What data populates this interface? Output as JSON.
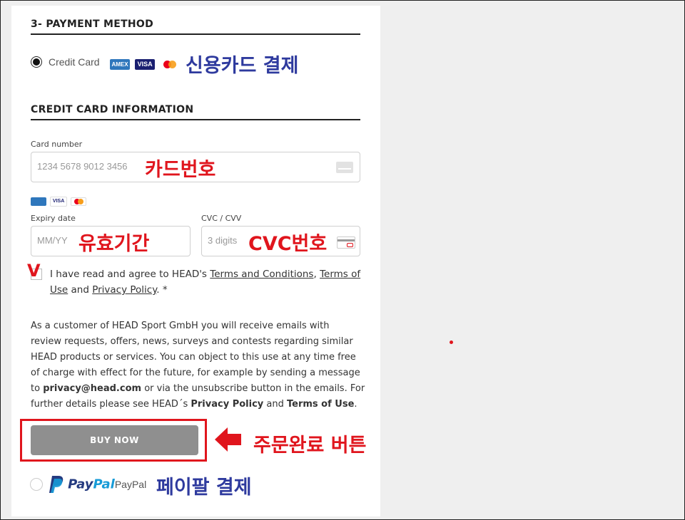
{
  "payment": {
    "section_title": "3- PAYMENT METHOD",
    "credit_card_label": "Credit Card",
    "card_brands": [
      "AMEX",
      "VISA",
      "Mastercard"
    ],
    "annotation_credit": "신용카드 결제"
  },
  "card_info": {
    "section_title": "CREDIT CARD INFORMATION",
    "card_number_label": "Card number",
    "card_number_placeholder": "1234 5678 9012 3456",
    "annotation_card_number": "카드번호",
    "expiry_label": "Expiry date",
    "expiry_placeholder": "MM/YY",
    "annotation_expiry": "유효기간",
    "cvc_label": "CVC / CVV",
    "cvc_placeholder": "3 digits",
    "annotation_cvc": "CVC번호"
  },
  "agreement": {
    "check_mark": "V",
    "prefix": "I have read and agree to HEAD's ",
    "terms_conditions": "Terms and Conditions",
    "comma": ", ",
    "terms_use": "Terms of Use",
    "and": " and ",
    "privacy_policy": "Privacy Policy",
    "suffix": ". *"
  },
  "notice": {
    "line1": "As a customer of HEAD Sport GmbH you will receive emails with",
    "line2": "review requests, offers, news, surveys and contests regarding similar",
    "line3": "HEAD products or services. You can object to this use at any time free",
    "line4": "of charge with effect for the future, for example by sending a message",
    "line5_prefix": "to ",
    "email": "privacy@head.com",
    "line5_suffix": " or via the unsubscribe button in the emails. For",
    "line6_prefix": "further details please see HEAD´s ",
    "privacy_policy": "Privacy Policy",
    "line6_and": " and ",
    "terms_of_use": "Terms of Use",
    "line6_suffix": "."
  },
  "buy_button": {
    "label": "BUY NOW",
    "annotation": "주문완료 버튼"
  },
  "paypal": {
    "logo_pay": "Pay",
    "logo_pal": "Pal",
    "label": "PayPal",
    "annotation": "페이팔 결제"
  },
  "colors": {
    "annotation_red": "#e0151d",
    "annotation_blue": "#2e3a9e",
    "button_gray": "#8f8f8f",
    "paypal_dark": "#253b80",
    "paypal_light": "#179bd7"
  }
}
